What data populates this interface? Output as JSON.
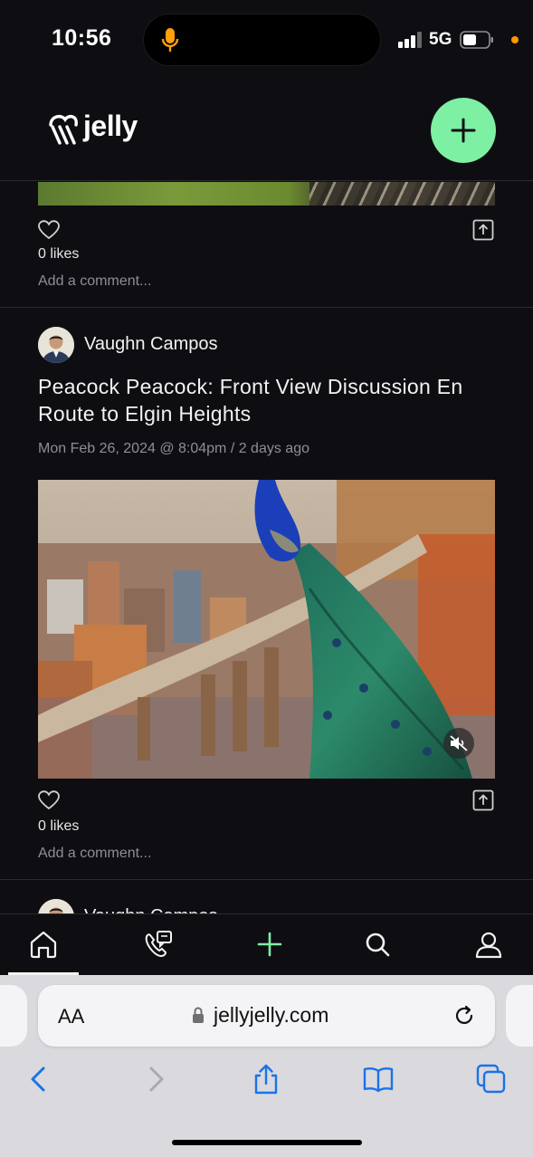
{
  "status_bar": {
    "time": "10:56",
    "network": "5G"
  },
  "header": {
    "logo_text": "jelly",
    "fab_icon": "plus-icon"
  },
  "feed": {
    "previous_post": {
      "likes": "0 likes",
      "comment_placeholder": "Add a comment..."
    },
    "post": {
      "author": "Vaughn Campos",
      "title": "Peacock Peacock: Front View Discussion En Route to Elgin Heights",
      "date": "Mon Feb 26, 2024 @ 8:04pm / 2 days ago",
      "likes": "0 likes",
      "comment_placeholder": "Add a comment..."
    },
    "next_post": {
      "author": "Vaughn Campos"
    }
  },
  "bottom_nav": {
    "items": [
      "home-icon",
      "video-call-icon",
      "plus-icon",
      "search-icon",
      "profile-icon"
    ],
    "active": "home-icon",
    "accent_color": "#7ef0a4"
  },
  "safari": {
    "aa_label": "AA",
    "url": "jellyjelly.com",
    "toolbar": [
      "back-icon",
      "forward-icon",
      "share-icon",
      "bookmarks-icon",
      "tabs-icon"
    ],
    "accent_color": "#1a73e8"
  }
}
